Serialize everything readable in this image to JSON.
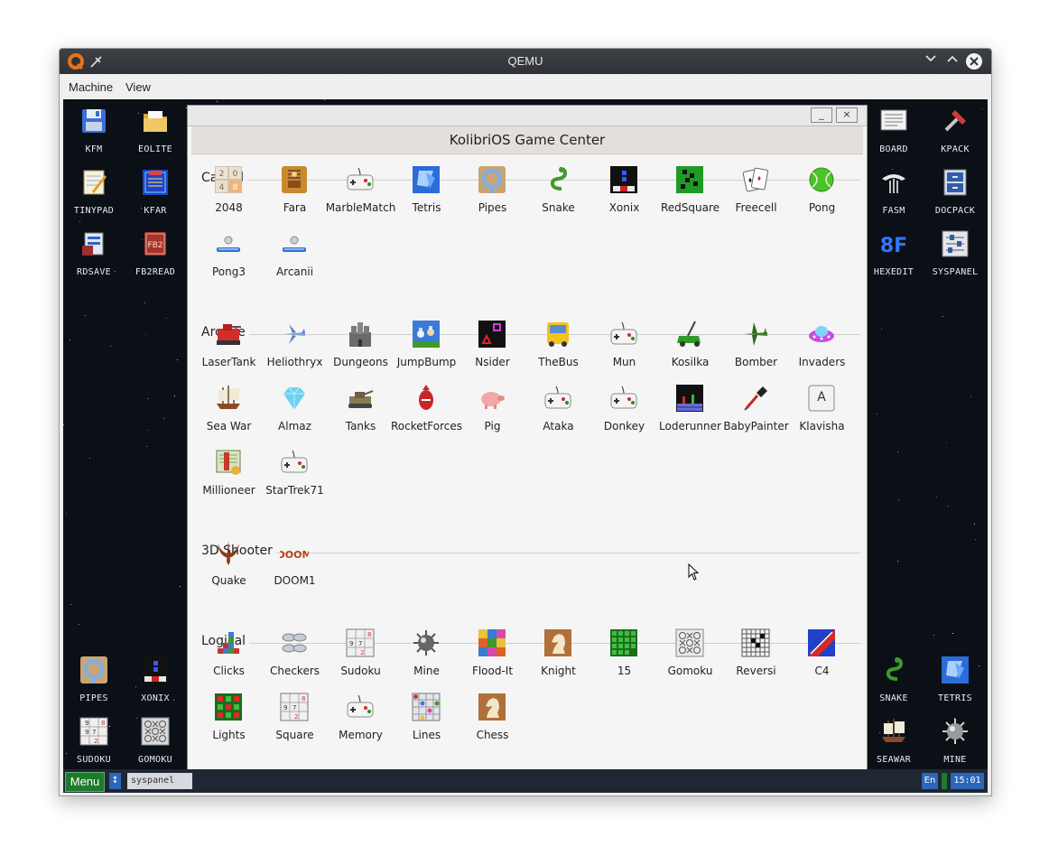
{
  "window": {
    "title": "QEMU"
  },
  "menubar": {
    "machine": "Machine",
    "view": "View"
  },
  "desktop_icons": {
    "left": [
      "KFM",
      "EOLITE",
      "TINYPAD",
      "KFAR",
      "RDSAVE",
      "FB2READ",
      "PIPES",
      "XONIX",
      "SUDOKU",
      "GOMOKU"
    ],
    "right": [
      "BOARD",
      "KPACK",
      "FASM",
      "DOCPACK",
      "HEXEDIT",
      "SYSPANEL",
      "SNAKE",
      "TETRIS",
      "SEAWAR",
      "MINE"
    ]
  },
  "icon_texts": {
    "fb2": "FB2",
    "hex": "8F",
    "sudoku": [
      "9",
      "7",
      "8",
      "2"
    ],
    "n2048": [
      "2",
      "0",
      "4",
      "8"
    ],
    "klavisha": "A",
    "doom": "DOOM",
    "n15": "15"
  },
  "game_center": {
    "title": "KolibriOS Game Center",
    "minimize": "_",
    "close": "×",
    "sections": {
      "casual": {
        "name": "Casual",
        "games": [
          "2048",
          "Fara",
          "MarbleMatch",
          "Tetris",
          "Pipes",
          "Snake",
          "Xonix",
          "RedSquare",
          "Freecell",
          "Pong",
          "Pong3",
          "Arcanii"
        ]
      },
      "arcade": {
        "name": "Arcade",
        "games": [
          "LaserTank",
          "Heliothryx",
          "Dungeons",
          "JumpBump",
          "Nsider",
          "TheBus",
          "Mun",
          "Kosilka",
          "Bomber",
          "Invaders",
          "Sea War",
          "Almaz",
          "Tanks",
          "RocketForces",
          "Pig",
          "Ataka",
          "Donkey",
          "Loderunner",
          "BabyPainter",
          "Klavisha",
          "Millioneer",
          "StarTrek71"
        ]
      },
      "shooter": {
        "name": "3D Shooter",
        "games": [
          "Quake",
          "DOOM1"
        ]
      },
      "logical": {
        "name": "Logical",
        "games": [
          "Clicks",
          "Checkers",
          "Sudoku",
          "Mine",
          "Flood-It",
          "Knight",
          "15",
          "Gomoku",
          "Reversi",
          "C4",
          "Lights",
          "Square",
          "Memory",
          "Lines",
          "Chess"
        ]
      }
    }
  },
  "taskbar": {
    "menu": "Menu",
    "switch": "↕",
    "task": "syspanel",
    "lang": "En",
    "clock": "15:01"
  },
  "colors": {
    "desktop": "#0b1017",
    "taskbar": "#1e2733",
    "menu_green": "#1e7a2c",
    "accent_blue": "#2b66b8"
  }
}
